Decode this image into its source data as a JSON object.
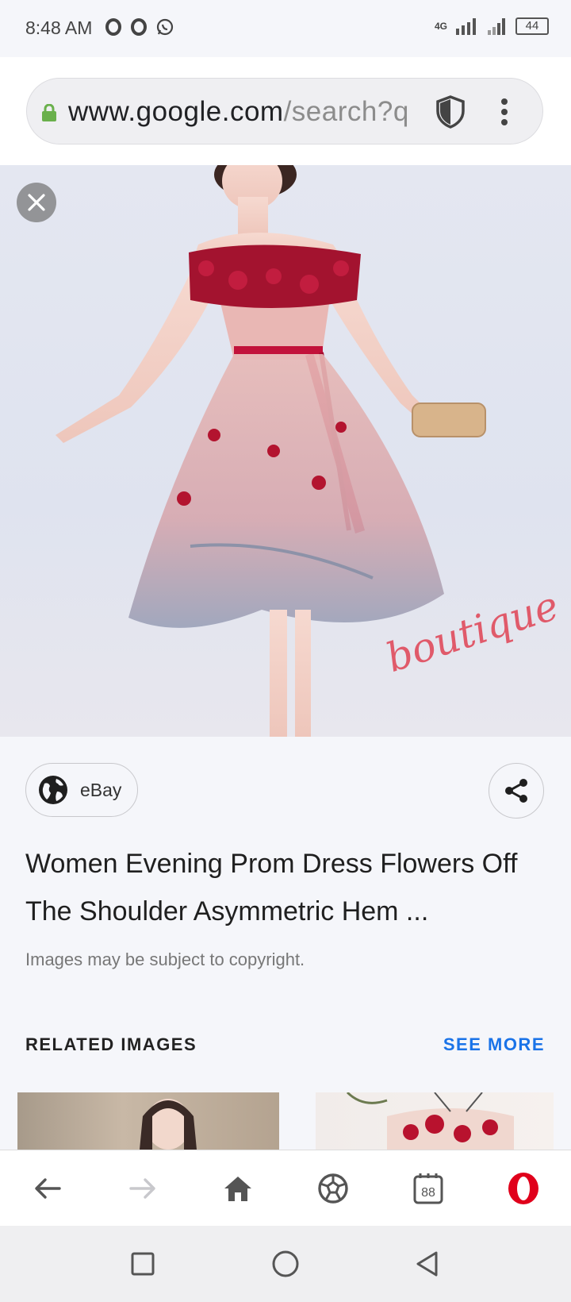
{
  "status_bar": {
    "time": "8:48 AM",
    "notification_icons": [
      "opera-icon",
      "opera-icon",
      "whatsapp-icon"
    ],
    "network_label": "4G",
    "battery_level": "44"
  },
  "browser": {
    "url_host": "www.google.com",
    "url_path": "/search?q",
    "icons": [
      "lock-icon",
      "shield-icon",
      "menu-dots-icon"
    ],
    "lock_color": "#6ab04c"
  },
  "image_viewer": {
    "watermark": "boutique",
    "source": {
      "name": "eBay"
    },
    "title": "Women Evening Prom Dress Flowers Off The Shoulder Asymmetric Hem ...",
    "copyright_note": "Images may be subject to copyright.",
    "related_heading": "RELATED IMAGES",
    "see_more_label": "SEE MORE",
    "accent_color": "#1a73e8"
  },
  "bottom_nav": {
    "items": [
      "back-icon",
      "forward-icon",
      "home-icon",
      "soccer-ball-icon",
      "tabs-icon",
      "opera-menu-icon"
    ],
    "tabs_count": "88",
    "brand_color": "#e0001b"
  },
  "system_nav": {
    "items": [
      "recents-icon",
      "home-circle-icon",
      "back-triangle-icon"
    ]
  }
}
